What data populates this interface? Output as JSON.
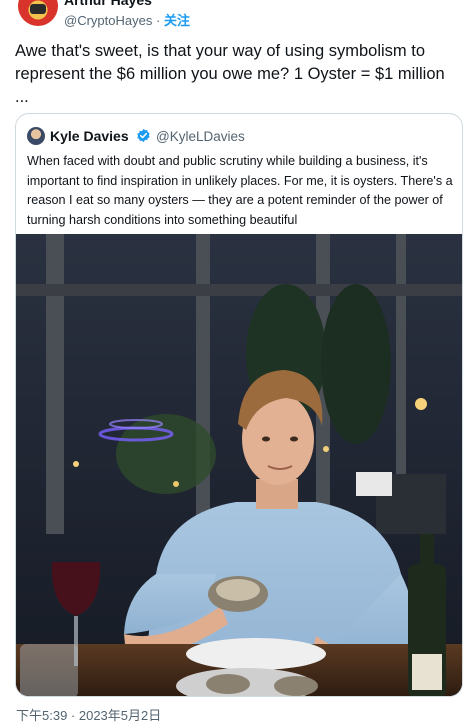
{
  "author": {
    "name": "Arthur Hayes",
    "handle": "@CryptoHayes",
    "separator": "·",
    "follow_label": "关注"
  },
  "tweet": {
    "text": "Awe that's sweet, is that your way of using symbolism to represent the $6 million you owe me? 1 Oyster = $1 million ..."
  },
  "quoted_tweet": {
    "name": "Kyle Davies",
    "handle": "@KyleLDavies",
    "verified": true,
    "text": "When faced with doubt and public scrutiny while building a business, it's important to find inspiration in unlikely places. For me, it is oysters. There's a reason I eat so many oysters — they are a potent reminder of the power of turning harsh conditions into something beautiful",
    "media": {
      "type": "photo",
      "icon": "photo-of-man-with-oyster"
    }
  },
  "timestamp": "下午5:39 · 2023年5月2日",
  "colors": {
    "accent": "#1d9bf0",
    "secondary_text": "#536471",
    "border": "#cfd9de"
  }
}
